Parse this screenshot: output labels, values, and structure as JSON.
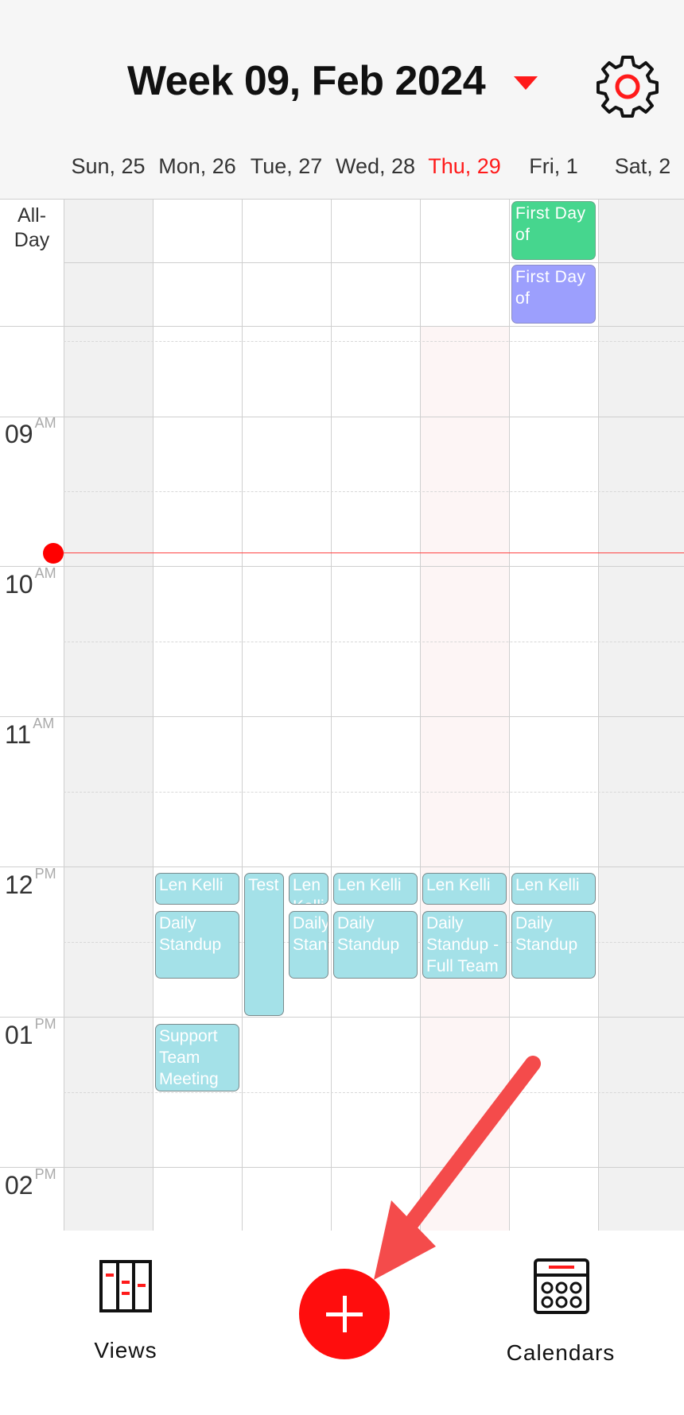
{
  "header": {
    "title": "Week 09, Feb 2024",
    "days": [
      {
        "label": "Sun, 25",
        "today": false
      },
      {
        "label": "Mon, 26",
        "today": false
      },
      {
        "label": "Tue, 27",
        "today": false
      },
      {
        "label": "Wed, 28",
        "today": false
      },
      {
        "label": "Thu, 29",
        "today": true
      },
      {
        "label": "Fri, 1",
        "today": false
      },
      {
        "label": "Sat, 2",
        "today": false
      }
    ]
  },
  "grid": {
    "allday_label": "All-Day",
    "times": [
      {
        "hour": "09",
        "ampm": "AM"
      },
      {
        "hour": "10",
        "ampm": "AM"
      },
      {
        "hour": "11",
        "ampm": "AM"
      },
      {
        "hour": "12",
        "ampm": "PM"
      },
      {
        "hour": "01",
        "ampm": "PM"
      },
      {
        "hour": "02",
        "ampm": "PM"
      }
    ],
    "allday_events": [
      {
        "title": "First Day of",
        "color": "green"
      },
      {
        "title": "First Day of",
        "color": "purple"
      }
    ],
    "events": {
      "mon_len": "Len Kelli",
      "mon_standup": "Daily Standup",
      "mon_support": "Support Team Meeting",
      "tue_test": "Test",
      "tue_len": "Len Kelli",
      "tue_standup": "Daily Standup",
      "wed_len": "Len Kelli",
      "wed_standup": "Daily Standup",
      "thu_len": "Len Kelli",
      "thu_standup": "Daily Standup - Full Team",
      "fri_len": "Len Kelli",
      "fri_standup": "Daily Standup"
    }
  },
  "nav": {
    "views_label": "Views",
    "calendars_label": "Calendars"
  },
  "colors": {
    "accent": "#ff0d0d",
    "event_cyan": "#a4e1e8",
    "event_green": "#46d68e",
    "event_purple": "#9c9ffd",
    "arrow": "#f44b4b"
  },
  "icons": [
    "dropdown-arrow-icon",
    "gear-icon",
    "views-icon",
    "add-icon",
    "calendars-icon"
  ]
}
